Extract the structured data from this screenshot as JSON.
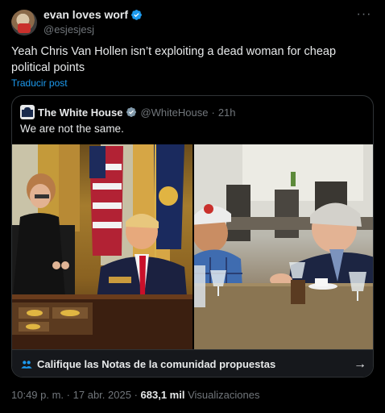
{
  "author": {
    "display_name": "evan loves worf",
    "handle": "@esjesjesj",
    "verified": true,
    "avatar_icon": "user-avatar"
  },
  "tweet": {
    "text": "Yeah Chris Van Hollen isn’t exploiting a dead woman for cheap political points",
    "translate_link": "Traducir post",
    "more_icon": "more-dots-icon"
  },
  "quote": {
    "display_name": "The White House",
    "handle": "@WhiteHouse",
    "separator": "·",
    "time": "21h",
    "verified": true,
    "text": "We are not the same."
  },
  "community_notes": {
    "label": "Califique las Notas de la comunidad propuestas",
    "icon": "people-icon",
    "arrow_icon": "arrow-right-icon"
  },
  "meta": {
    "time": "10:49 p. m.",
    "separator1": "·",
    "date": "17 abr. 2025",
    "separator2": "·",
    "views_count": "683,1 mil",
    "views_label": "Visualizaciones"
  },
  "colors": {
    "background": "#000000",
    "text": "#e7e9ea",
    "secondary": "#71767b",
    "link": "#1d9bf0",
    "verified": "#1d9bf0",
    "border": "#2f3336"
  }
}
